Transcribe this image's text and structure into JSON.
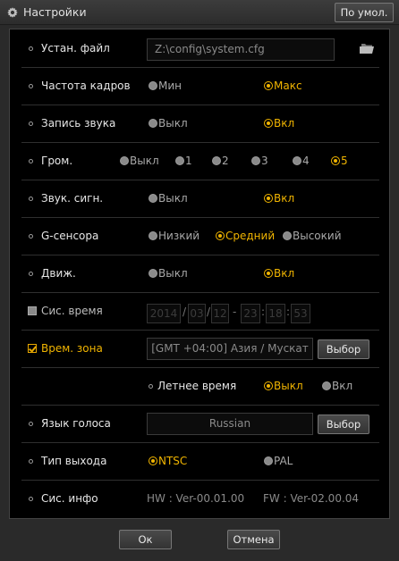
{
  "window": {
    "title": "Настройки",
    "defaults_button": "По умол."
  },
  "rows": {
    "file": {
      "label": "Устан. файл",
      "value": "Z:\\config\\system.cfg"
    },
    "framerate": {
      "label": "Частота кадров",
      "options": [
        "Мин",
        "Макс"
      ],
      "selected": "Макс"
    },
    "audio": {
      "label": "Запись звука",
      "options": [
        "Выкл",
        "Вкл"
      ],
      "selected": "Вкл"
    },
    "volume": {
      "label": "Гром.",
      "options": [
        "Выкл",
        "1",
        "2",
        "3",
        "4",
        "5"
      ],
      "selected": "5"
    },
    "beep": {
      "label": "Звук. сигн.",
      "options": [
        "Выкл",
        "Вкл"
      ],
      "selected": "Вкл"
    },
    "gsensor": {
      "label": "G-сенсора",
      "options": [
        "Низкий",
        "Средний",
        "Высокий"
      ],
      "selected": "Средний"
    },
    "motion": {
      "label": "Движ.",
      "options": [
        "Выкл",
        "Вкл"
      ],
      "selected": "Вкл"
    },
    "systime": {
      "label": "Сис. время",
      "checked": false,
      "year": "2014",
      "month": "03",
      "day": "12",
      "hour": "23",
      "minute": "18",
      "second": "53",
      "date_sep": "/",
      "mid_sep": "-",
      "time_sep": ":"
    },
    "timezone": {
      "label": "Врем. зона",
      "checked": true,
      "value": "[GMT +04:00] Азия / Мускат",
      "button": "Выбор"
    },
    "dst": {
      "label": "Летнее время",
      "options": [
        "Выкл",
        "Вкл"
      ],
      "selected": "Выкл"
    },
    "voice": {
      "label": "Язык голоса",
      "value": "Russian",
      "button": "Выбор"
    },
    "output": {
      "label": "Тип выхода",
      "options": [
        "NTSC",
        "PAL"
      ],
      "selected": "NTSC"
    },
    "sysinfo": {
      "label": "Сис. инфо",
      "hw": "HW : Ver-00.01.00",
      "fw": "FW : Ver-02.00.04"
    }
  },
  "footer": {
    "ok": "Ок",
    "cancel": "Отмена"
  },
  "colors": {
    "accent": "#f0b400",
    "panel": "#000000",
    "chrome": "#2a2a2a"
  },
  "icons": {
    "title": "gear-icon",
    "file": "folder-icon"
  }
}
